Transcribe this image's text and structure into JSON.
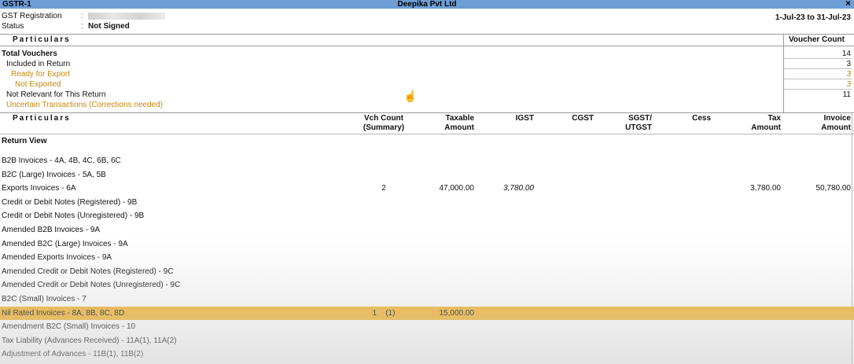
{
  "window": {
    "title_left": "GSTR-1",
    "company": "Deepika Pvt Ltd",
    "close_icon": "×"
  },
  "info": {
    "gst_registration_label": "GST Registration",
    "status_label": "Status",
    "status_value": "Not Signed",
    "colon": ":",
    "period": "1-Jul-23 to 31-Jul-23"
  },
  "summary": {
    "header_particulars": "Particulars",
    "header_voucher_count": "Voucher Count",
    "rows": [
      {
        "label": "Total Vouchers",
        "count": "14"
      },
      {
        "label": "Included in Return",
        "count": "3"
      },
      {
        "label": "Ready for Export",
        "count": "3"
      },
      {
        "label": "Not Exported",
        "count": "3"
      },
      {
        "label": "Not Relevant for This Return",
        "count": "11"
      },
      {
        "label": "Uncertain Transactions (Corrections needed)",
        "count": ""
      }
    ]
  },
  "table": {
    "headers": {
      "particulars": "Particulars",
      "vch_count_1": "Vch Count",
      "vch_count_2": "(Summary)",
      "taxable_1": "Taxable",
      "taxable_2": "Amount",
      "igst": "IGST",
      "cgst": "CGST",
      "sgst_1": "SGST/",
      "sgst_2": "UTGST",
      "cess": "Cess",
      "tax_1": "Tax",
      "tax_2": "Amount",
      "invoice_1": "Invoice",
      "invoice_2": "Amount"
    },
    "section_title": "Return View",
    "rows": [
      {
        "name": "B2B Invoices - 4A, 4B, 4C, 6B, 6C",
        "vch": "",
        "taxable": "",
        "igst": "",
        "tax": "",
        "invoice": ""
      },
      {
        "name": "B2C (Large) Invoices - 5A, 5B",
        "vch": "",
        "taxable": "",
        "igst": "",
        "tax": "",
        "invoice": ""
      },
      {
        "name": "Exports Invoices - 6A",
        "vch": "2",
        "taxable": "47,000.00",
        "igst": "3,780.00",
        "tax": "3,780.00",
        "invoice": "50,780.00"
      },
      {
        "name": "Credit or Debit Notes (Registered) - 9B",
        "vch": "",
        "taxable": "",
        "igst": "",
        "tax": "",
        "invoice": ""
      },
      {
        "name": "Credit or Debit Notes (Unregistered) - 9B",
        "vch": "",
        "taxable": "",
        "igst": "",
        "tax": "",
        "invoice": ""
      },
      {
        "name": "Amended B2B Invoices - 9A",
        "vch": "",
        "taxable": "",
        "igst": "",
        "tax": "",
        "invoice": ""
      },
      {
        "name": "Amended B2C (Large) Invoices - 9A",
        "vch": "",
        "taxable": "",
        "igst": "",
        "tax": "",
        "invoice": ""
      },
      {
        "name": "Amended Exports Invoices - 9A",
        "vch": "",
        "taxable": "",
        "igst": "",
        "tax": "",
        "invoice": ""
      },
      {
        "name": "Amended Credit or Debit Notes (Registered) - 9C",
        "vch": "",
        "taxable": "",
        "igst": "",
        "tax": "",
        "invoice": ""
      },
      {
        "name": "Amended Credit or Debit Notes (Unregistered) - 9C",
        "vch": "",
        "taxable": "",
        "igst": "",
        "tax": "",
        "invoice": ""
      },
      {
        "name": "B2C (Small) Invoices - 7",
        "vch": "",
        "taxable": "",
        "igst": "",
        "tax": "",
        "invoice": ""
      },
      {
        "name": "Nil Rated Invoices - 8A, 8B, 8C, 8D",
        "vch": "1    (1)",
        "taxable": "15,000.00",
        "igst": "",
        "tax": "",
        "invoice": ""
      },
      {
        "name": "Amendment B2C (Small) Invoices - 10",
        "vch": "",
        "taxable": "",
        "igst": "",
        "tax": "",
        "invoice": ""
      },
      {
        "name": "Tax Liability (Advances Received) - 11A(1), 11A(2)",
        "vch": "",
        "taxable": "",
        "igst": "",
        "tax": "",
        "invoice": ""
      },
      {
        "name": "Adjustment of Advances - 11B(1), 11B(2)",
        "vch": "",
        "taxable": "",
        "igst": "",
        "tax": "",
        "invoice": ""
      }
    ]
  },
  "icons": {
    "cursor": "hand-pointer-icon"
  },
  "colors": {
    "titlebar": "#6d9ed6",
    "highlight": "#f2b531",
    "orange_text": "#c8870a"
  }
}
